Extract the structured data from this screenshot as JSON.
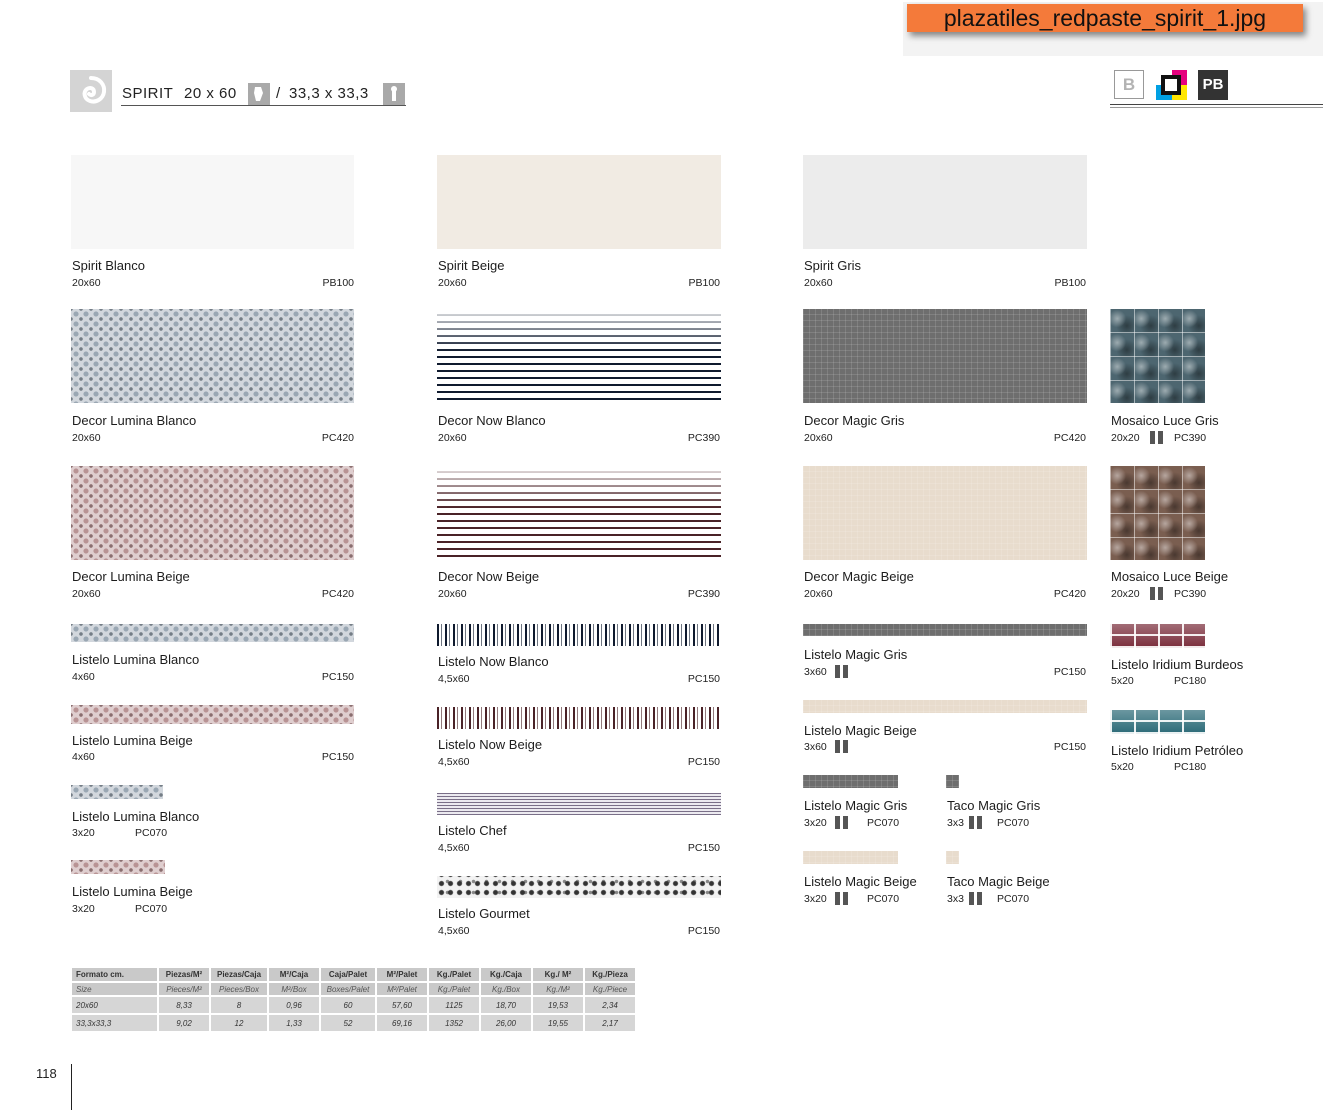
{
  "filename": "plazatiles_redpaste_spirit_1.jpg",
  "header": {
    "series": "SPIRIT",
    "format_a": "20 x 60",
    "separator": "/",
    "format_b": "33,3 x 33,3",
    "badge_b": "B",
    "badge_pb": "PB"
  },
  "tiles": [
    {
      "id": "spirit-blanco",
      "name": "Spirit Blanco",
      "size": "20x60",
      "code": "PB100",
      "pattern": "plain",
      "color": "#f7f7f7"
    },
    {
      "id": "spirit-beige",
      "name": "Spirit Beige",
      "size": "20x60",
      "code": "PB100",
      "pattern": "plain",
      "color": "#f1ebe3"
    },
    {
      "id": "spirit-gris",
      "name": "Spirit Gris",
      "size": "20x60",
      "code": "PB100",
      "pattern": "plain",
      "color": "#ececec"
    },
    {
      "id": "decor-lumina-blanco",
      "name": "Decor Lumina Blanco",
      "size": "20x60",
      "code": "PC420",
      "pattern": "dots",
      "color": "#9aa7b3"
    },
    {
      "id": "decor-now-blanco",
      "name": "Decor Now Blanco",
      "size": "20x60",
      "code": "PC390",
      "pattern": "stripes",
      "color": "#0f1a2e"
    },
    {
      "id": "decor-magic-gris",
      "name": "Decor Magic Gris",
      "size": "20x60",
      "code": "PC420",
      "pattern": "mosaic",
      "color": "#6e6e6e"
    },
    {
      "id": "mosaico-luce-gris",
      "name": "Mosaico Luce Gris",
      "size": "20x20",
      "code": "PC390",
      "pattern": "glass",
      "color": "#4d6670"
    },
    {
      "id": "decor-lumina-beige",
      "name": "Decor Lumina Beige",
      "size": "20x60",
      "code": "PC420",
      "pattern": "dots",
      "color": "#b89394"
    },
    {
      "id": "decor-now-beige",
      "name": "Decor Now Beige",
      "size": "20x60",
      "code": "PC390",
      "pattern": "stripes",
      "color": "#4a2227"
    },
    {
      "id": "decor-magic-beige",
      "name": "Decor Magic Beige",
      "size": "20x60",
      "code": "PC420",
      "pattern": "mosaic",
      "color": "#e8dccd"
    },
    {
      "id": "mosaico-luce-beige",
      "name": "Mosaico Luce Beige",
      "size": "20x20",
      "code": "PC390",
      "pattern": "glass",
      "color": "#7a5e50"
    },
    {
      "id": "listelo-lumina-blanco-60",
      "name": "Listelo Lumina Blanco",
      "size": "4x60",
      "code": "PC150",
      "pattern": "dots",
      "color": "#9aa7b3"
    },
    {
      "id": "listelo-now-blanco",
      "name": "Listelo Now Blanco",
      "size": "4,5x60",
      "code": "PC150",
      "pattern": "vstripes",
      "color": "#0f1a2e"
    },
    {
      "id": "listelo-magic-gris-60",
      "name": "Listelo Magic Gris",
      "size": "3x60",
      "code": "PC150",
      "pattern": "mosaic",
      "color": "#6e6e6e"
    },
    {
      "id": "listelo-iridium-burdeos",
      "name": "Listelo Iridium Burdeos",
      "size": "5x20",
      "code": "PC180",
      "pattern": "iridium",
      "color": "#7a2d3b"
    },
    {
      "id": "listelo-lumina-beige-60",
      "name": "Listelo Lumina Beige",
      "size": "4x60",
      "code": "PC150",
      "pattern": "dots",
      "color": "#b89394"
    },
    {
      "id": "listelo-now-beige",
      "name": "Listelo Now Beige",
      "size": "4,5x60",
      "code": "PC150",
      "pattern": "vstripes",
      "color": "#4a2227"
    },
    {
      "id": "listelo-magic-beige-60",
      "name": "Listelo Magic Beige",
      "size": "3x60",
      "code": "PC150",
      "pattern": "mosaic",
      "color": "#e8dccd"
    },
    {
      "id": "listelo-iridium-petroleo",
      "name": "Listelo Iridium Petróleo",
      "size": "5x20",
      "code": "PC180",
      "pattern": "iridium",
      "color": "#2b6a77"
    },
    {
      "id": "listelo-lumina-blanco-20",
      "name": "Listelo Lumina Blanco",
      "size": "3x20",
      "code": "PC070",
      "pattern": "dots",
      "color": "#9aa7b3"
    },
    {
      "id": "listelo-chef",
      "name": "Listelo Chef",
      "size": "4,5x60",
      "code": "PC150",
      "pattern": "chef",
      "color": "#7a6f88"
    },
    {
      "id": "listelo-magic-gris-20",
      "name": "Listelo Magic Gris",
      "size": "3x20",
      "code": "PC070",
      "pattern": "mosaic",
      "color": "#6e6e6e"
    },
    {
      "id": "taco-magic-gris",
      "name": "Taco Magic Gris",
      "size": "3x3",
      "code": "PC070",
      "pattern": "mosaic",
      "color": "#6e6e6e"
    },
    {
      "id": "listelo-lumina-beige-20",
      "name": "Listelo Lumina Beige",
      "size": "3x20",
      "code": "PC070",
      "pattern": "dots",
      "color": "#b89394"
    },
    {
      "id": "listelo-gourmet",
      "name": "Listelo Gourmet",
      "size": "4,5x60",
      "code": "PC150",
      "pattern": "gourmet",
      "color": "#333333"
    },
    {
      "id": "listelo-magic-beige-20",
      "name": "Listelo Magic Beige",
      "size": "3x20",
      "code": "PC070",
      "pattern": "mosaic",
      "color": "#e8dccd"
    },
    {
      "id": "taco-magic-beige",
      "name": "Taco Magic Beige",
      "size": "3x3",
      "code": "PC070",
      "pattern": "mosaic",
      "color": "#e8dccd"
    }
  ],
  "table": {
    "header": [
      "Formato cm.",
      "Piezas/M²",
      "Piezas/Caja",
      "M²/Caja",
      "Caja/Palet",
      "M²/Palet",
      "Kg./Palet",
      "Kg./Caja",
      "Kg./ M²",
      "Kg./Pieza"
    ],
    "subheader": [
      "Size",
      "Pieces/M²",
      "Pieces/Box",
      "M²/Box",
      "Boxes/Palet",
      "M²/Palet",
      "Kg./Palet",
      "Kg./Box",
      "Kg./M²",
      "Kg./Piece"
    ],
    "rows": [
      [
        "20x60",
        "8,33",
        "8",
        "0,96",
        "60",
        "57,60",
        "1125",
        "18,70",
        "19,53",
        "2,34"
      ],
      [
        "33,3x33,3",
        "9,02",
        "12",
        "1,33",
        "52",
        "69,16",
        "1352",
        "26,00",
        "19,55",
        "2,17"
      ]
    ]
  },
  "page_number": "118"
}
